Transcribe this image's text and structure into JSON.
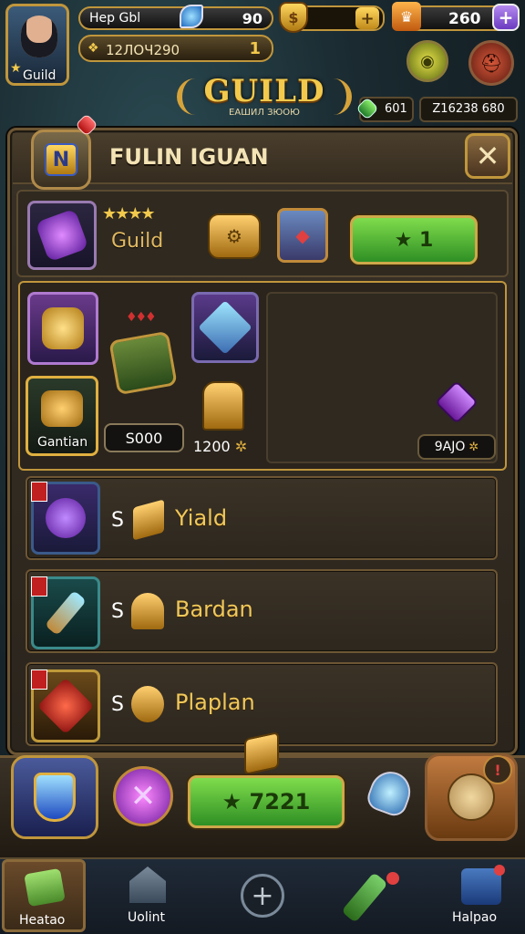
{
  "player": {
    "name": "Hep Gbl",
    "avatar_label": "Guild",
    "xp_text": "12ЛОЧ290",
    "level": "1"
  },
  "currency": {
    "gems": "90",
    "gold_icon": "coin-plus-icon",
    "crowns": "260"
  },
  "resources": {
    "green_gem_count": "601",
    "total": "Z16238 680"
  },
  "title": {
    "main": "GUILD",
    "sub": "ЕАШИЛ ЗЮОЮ"
  },
  "panel": {
    "header": "FULIN IGUAN",
    "guild_label": "Guild",
    "stars": "★★★★",
    "confirm_button": "★ 1",
    "items": {
      "gantian_label": "Gantian",
      "price_1": "S000",
      "price_2": "1200",
      "price_3": "9AJO"
    }
  },
  "list": [
    {
      "prefix": "S",
      "name": "Yiald"
    },
    {
      "prefix": "S",
      "name": "Bardan"
    },
    {
      "prefix": "S",
      "name": "Plaplan"
    }
  ],
  "bottom_bar": {
    "buy_button": "★ 7221"
  },
  "nav": {
    "items": [
      {
        "label": "Heatao"
      },
      {
        "label": "Uolint"
      },
      {
        "label": ""
      },
      {
        "label": ""
      },
      {
        "label": "Halpao"
      }
    ]
  },
  "colors": {
    "accent_gold": "#f2c94c",
    "button_green": "#4cc23a",
    "panel_brown": "#3a3227"
  }
}
